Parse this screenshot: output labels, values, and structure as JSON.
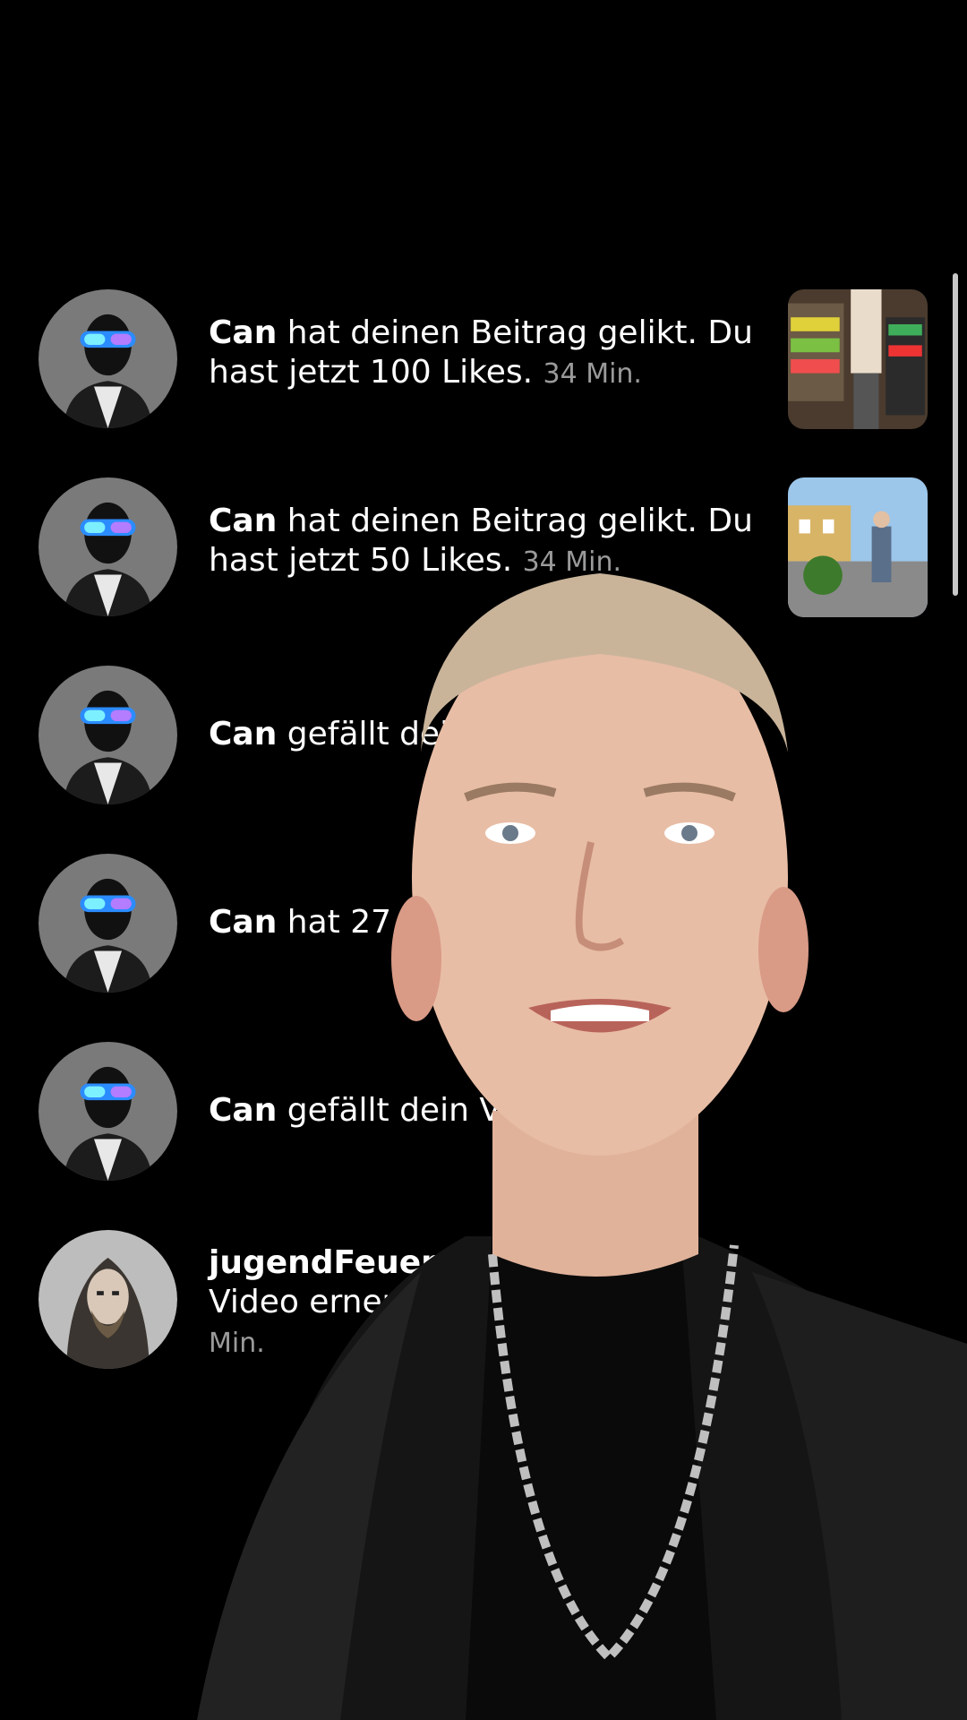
{
  "notifications": [
    {
      "user": "Can",
      "text": " hat deinen Beitrag gelikt. Du hast jetzt 100 Likes. ",
      "time": "34 Min.",
      "avatar_icon": "masked-goggles-avatar",
      "thumbnail": "store-shelf-photo"
    },
    {
      "user": "Can",
      "text": " hat deinen Beitrag gelikt. Du hast jetzt 50 Likes. ",
      "time": "34 Min.",
      "avatar_icon": "masked-goggles-avatar",
      "thumbnail": "street-photo"
    },
    {
      "user": "Can",
      "text": " gefällt deine Sto",
      "time": "",
      "avatar_icon": "masked-goggles-avatar"
    },
    {
      "user": "Can",
      "text": " hat 27 Beiträge",
      "time": "",
      "avatar_icon": "masked-goggles-avatar"
    },
    {
      "user": "Can",
      "text": " gefällt dein Video.",
      "time": "",
      "avatar_icon": "masked-goggles-avatar"
    },
    {
      "user": "jugendFeuerwehr",
      "text": " Video erneut v",
      "time": "Min.",
      "avatar_icon": "long-haired-man-avatar"
    }
  ],
  "overlay": {
    "description_icon": "presenter-overlay"
  },
  "colors": {
    "background": "#000000",
    "text": "#ffffff",
    "muted": "#9a9a9a"
  }
}
